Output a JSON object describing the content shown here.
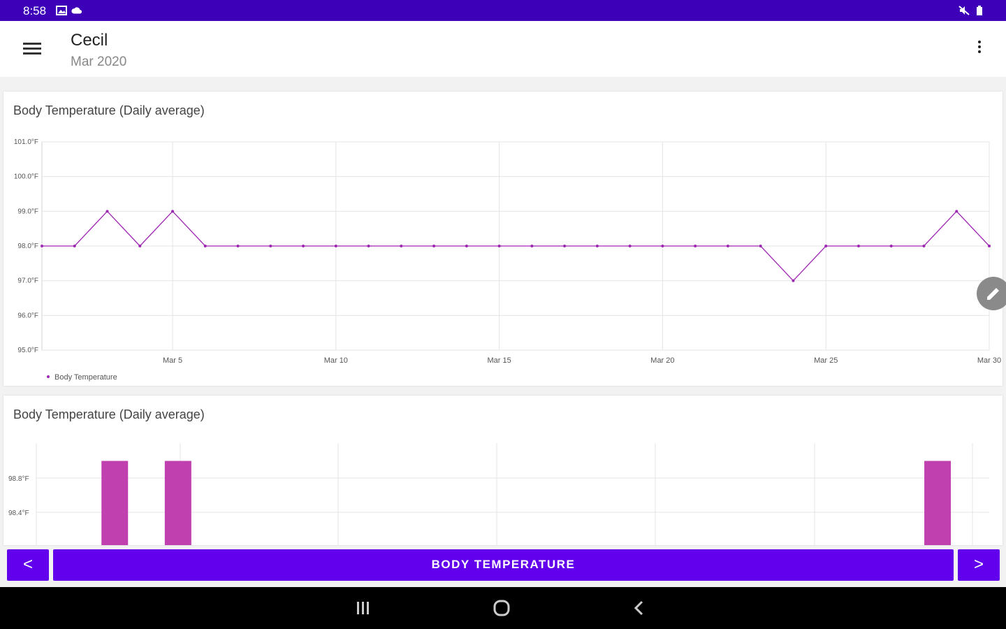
{
  "status_bar": {
    "time": "8:58",
    "left_icons": [
      "gallery-icon",
      "cloud-icon"
    ],
    "right_icons": [
      "mute-icon",
      "battery-icon"
    ],
    "color": "#3d00b8"
  },
  "app_bar": {
    "title": "Cecil",
    "subtitle": "Mar 2020"
  },
  "cards": [
    {
      "title": "Body Temperature (Daily average)"
    },
    {
      "title": "Body Temperature (Daily average)"
    }
  ],
  "chart_data": [
    {
      "type": "line",
      "title": "Body Temperature (Daily average)",
      "x": [
        1,
        2,
        3,
        4,
        5,
        6,
        7,
        8,
        9,
        10,
        11,
        12,
        13,
        14,
        15,
        16,
        17,
        18,
        19,
        20,
        21,
        22,
        23,
        24,
        25,
        26,
        27,
        28,
        29,
        30
      ],
      "series": [
        {
          "name": "Body Temperature",
          "color": "#9c27b0",
          "values": [
            98.0,
            98.0,
            99.0,
            98.0,
            99.0,
            98.0,
            98.0,
            98.0,
            98.0,
            98.0,
            98.0,
            98.0,
            98.0,
            98.0,
            98.0,
            98.0,
            98.0,
            98.0,
            98.0,
            98.0,
            98.0,
            98.0,
            98.0,
            97.0,
            98.0,
            98.0,
            98.0,
            98.0,
            99.0,
            98.0
          ]
        }
      ],
      "yticks": [
        "95.0°F",
        "96.0°F",
        "97.0°F",
        "98.0°F",
        "99.0°F",
        "100.0°F",
        "101.0°F"
      ],
      "xticks": [
        {
          "x": 5,
          "label": "Mar 5"
        },
        {
          "x": 10,
          "label": "Mar 10"
        },
        {
          "x": 15,
          "label": "Mar 15"
        },
        {
          "x": 20,
          "label": "Mar 20"
        },
        {
          "x": 25,
          "label": "Mar 25"
        },
        {
          "x": 30,
          "label": "Mar 30"
        }
      ],
      "ylim": [
        95,
        101
      ],
      "xlim": [
        1,
        30
      ],
      "grid": true,
      "legend": "bottom-left"
    },
    {
      "type": "bar",
      "title": "Body Temperature (Daily average)",
      "x": [
        3,
        5,
        29
      ],
      "values": [
        99.0,
        99.0,
        99.0
      ],
      "color": "#c040b0",
      "yticks": [
        {
          "value": 98.8,
          "label": "98.8°F"
        },
        {
          "value": 98.4,
          "label": "98.4°F"
        }
      ]
    }
  ],
  "bottom_bar": {
    "prev_label": "<",
    "main_label": "BODY TEMPERATURE",
    "next_label": ">",
    "color": "#6200ee"
  },
  "system_nav": [
    "recents-icon",
    "home-icon",
    "back-icon"
  ]
}
